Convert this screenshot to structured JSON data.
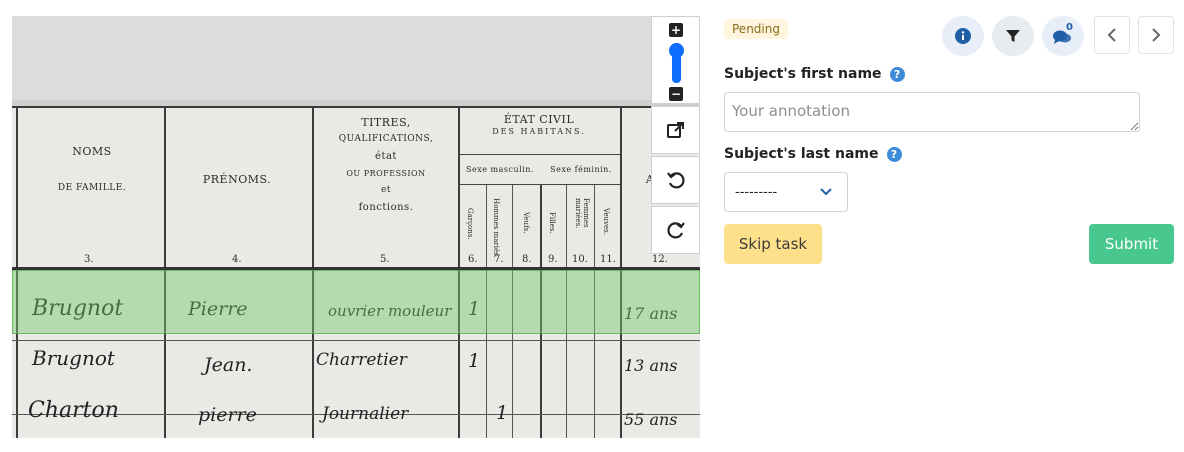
{
  "status_badge": "Pending",
  "fields": {
    "first_name": {
      "label": "Subject's first name",
      "help": "?",
      "placeholder": "Your annotation",
      "value": ""
    },
    "last_name": {
      "label": "Subject's last name",
      "help": "?",
      "selected": "---------"
    }
  },
  "actions": {
    "skip_label": "Skip task",
    "submit_label": "Submit"
  },
  "toolbar": {
    "chat_count": "0",
    "zoom_in": "+",
    "zoom_out": "−"
  },
  "document": {
    "headers": {
      "noms_line1": "NOMS",
      "noms_line2": "DE FAMILLE.",
      "prenoms": "PRÉNOMS.",
      "titres_1": "TITRES,",
      "titres_2": "QUALIFICATIONS,",
      "titres_3": "état",
      "titres_4": "OU PROFESSION",
      "titres_5": "et",
      "titres_6": "fonctions.",
      "etat_1": "ÉTAT CIVIL",
      "etat_2": "DES HABITANS.",
      "sexe_m": "Sexe masculin.",
      "sexe_f": "Sexe féminin.",
      "age": "A",
      "garcons": "Garçons.",
      "hommes": "Hommes mariés.",
      "veufs": "Veufs.",
      "filles": "Filles.",
      "femmes": "Femmes mariées.",
      "veuves": "Veuves."
    },
    "column_numbers": [
      "3.",
      "4.",
      "5.",
      "6.",
      "7.",
      "8.",
      "9.",
      "10.",
      "11.",
      "12."
    ],
    "rows": [
      {
        "nom": "Brugnot",
        "prenom": "Pierre",
        "profession": "ouvrier mouleur",
        "mark": "1",
        "age": "17 ans"
      },
      {
        "nom": "Brugnot",
        "prenom": "Jean.",
        "profession": "Charretier",
        "mark": "1",
        "age": "13 ans"
      },
      {
        "nom": "Charton",
        "prenom": "pierre",
        "profession": "Journalier",
        "mark": "1",
        "age": "55 ans"
      }
    ]
  }
}
